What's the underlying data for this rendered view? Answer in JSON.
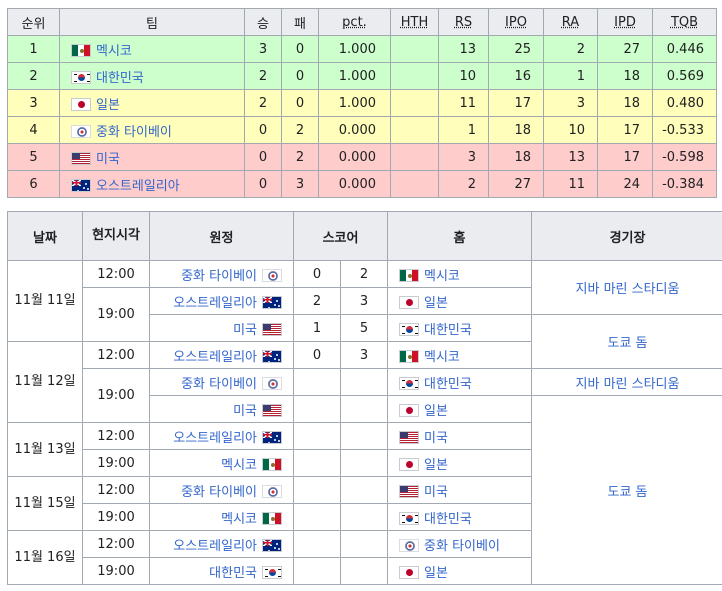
{
  "standings": {
    "headers": {
      "rank": "순위",
      "team": "팀",
      "w": "승",
      "l": "패",
      "pct": "pct.",
      "hth": "HTH",
      "rs": "RS",
      "ipo": "IPO",
      "ra": "RA",
      "ipd": "IPD",
      "tqb": "TQB"
    },
    "rows": [
      {
        "rank": "1",
        "team": "멕시코",
        "w": "3",
        "l": "0",
        "pct": "1.000",
        "hth": "",
        "rs": "13",
        "ipo": "25",
        "ra": "2",
        "ipd": "27",
        "tqb": "0.446"
      },
      {
        "rank": "2",
        "team": "대한민국",
        "w": "2",
        "l": "0",
        "pct": "1.000",
        "hth": "",
        "rs": "10",
        "ipo": "16",
        "ra": "1",
        "ipd": "18",
        "tqb": "0.569"
      },
      {
        "rank": "3",
        "team": "일본",
        "w": "2",
        "l": "0",
        "pct": "1.000",
        "hth": "",
        "rs": "11",
        "ipo": "17",
        "ra": "3",
        "ipd": "18",
        "tqb": "0.480"
      },
      {
        "rank": "4",
        "team": "중화 타이베이",
        "w": "0",
        "l": "2",
        "pct": "0.000",
        "hth": "",
        "rs": "1",
        "ipo": "18",
        "ra": "10",
        "ipd": "17",
        "tqb": "-0.533"
      },
      {
        "rank": "5",
        "team": "미국",
        "w": "0",
        "l": "2",
        "pct": "0.000",
        "hth": "",
        "rs": "3",
        "ipo": "18",
        "ra": "13",
        "ipd": "17",
        "tqb": "-0.598"
      },
      {
        "rank": "6",
        "team": "오스트레일리아",
        "w": "0",
        "l": "3",
        "pct": "0.000",
        "hth": "",
        "rs": "2",
        "ipo": "27",
        "ra": "11",
        "ipd": "24",
        "tqb": "-0.384"
      }
    ]
  },
  "schedule": {
    "headers": {
      "date": "날짜",
      "time": "현지시각",
      "away": "원정",
      "score": "스코어",
      "home": "홈",
      "venue": "경기장"
    },
    "dates": [
      "11월 11일",
      "11월 12일",
      "11월 13일",
      "11월 15일",
      "11월 16일"
    ],
    "venues": [
      "지바 마린 스타디움",
      "도쿄 돔",
      "지바 마린 스타디움",
      "도쿄 돔"
    ],
    "games": [
      {
        "time": "12:00",
        "away": "중화 타이베이",
        "away_score": "0",
        "home_score": "2",
        "home": "멕시코"
      },
      {
        "time": "19:00",
        "away": "오스트레일리아",
        "away_score": "2",
        "home_score": "3",
        "home": "일본"
      },
      {
        "time": "",
        "away": "미국",
        "away_score": "1",
        "home_score": "5",
        "home": "대한민국"
      },
      {
        "time": "12:00",
        "away": "오스트레일리아",
        "away_score": "0",
        "home_score": "3",
        "home": "멕시코"
      },
      {
        "time": "19:00",
        "away": "중화 타이베이",
        "away_score": "",
        "home_score": "",
        "home": "대한민국"
      },
      {
        "time": "",
        "away": "미국",
        "away_score": "",
        "home_score": "",
        "home": "일본"
      },
      {
        "time": "12:00",
        "away": "오스트레일리아",
        "away_score": "",
        "home_score": "",
        "home": "미국"
      },
      {
        "time": "19:00",
        "away": "멕시코",
        "away_score": "",
        "home_score": "",
        "home": "일본"
      },
      {
        "time": "12:00",
        "away": "중화 타이베이",
        "away_score": "",
        "home_score": "",
        "home": "미국"
      },
      {
        "time": "19:00",
        "away": "멕시코",
        "away_score": "",
        "home_score": "",
        "home": "대한민국"
      },
      {
        "time": "12:00",
        "away": "오스트레일리아",
        "away_score": "",
        "home_score": "",
        "home": "중화 타이베이"
      },
      {
        "time": "19:00",
        "away": "대한민국",
        "away_score": "",
        "home_score": "",
        "home": "일본"
      }
    ]
  },
  "flags": {
    "멕시코": "mexico-flag-icon",
    "대한민국": "south-korea-flag-icon",
    "일본": "japan-flag-icon",
    "중화 타이베이": "chinese-taipei-flag-icon",
    "미국": "usa-flag-icon",
    "오스트레일리아": "australia-flag-icon"
  }
}
